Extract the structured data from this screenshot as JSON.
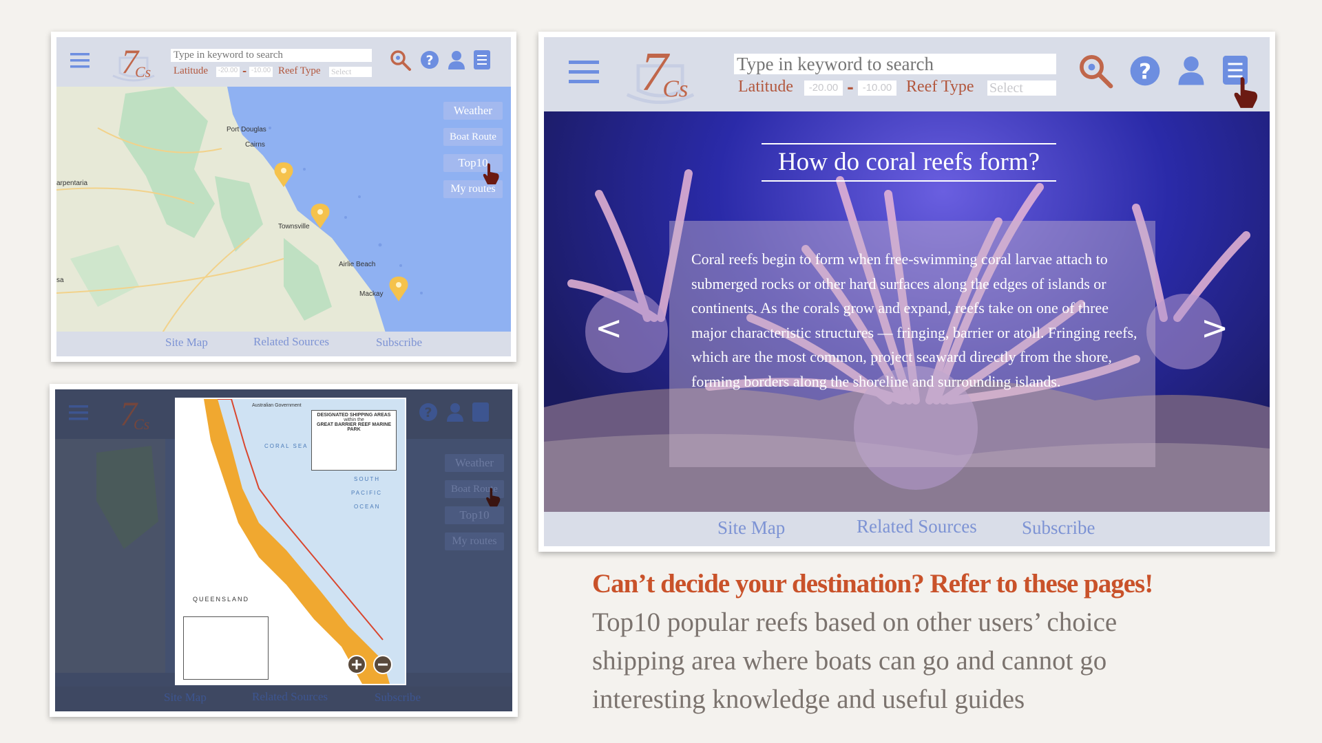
{
  "header": {
    "logo_text": "7Cs",
    "search_placeholder": "Type in keyword to search",
    "latitude_label": "Latitude",
    "lat_min": "-20.00",
    "lat_max": "-10.00",
    "reef_type_label": "Reef Type",
    "reef_type_value": "Select"
  },
  "footer": {
    "site_map": "Site Map",
    "related_sources": "Related Sources",
    "subscribe": "Subscribe"
  },
  "map_buttons": [
    "Weather",
    "Boat Route",
    "Top10",
    "My routes"
  ],
  "map_places": [
    "Port Douglas",
    "Cairns",
    "arpentaria",
    "Townsville",
    "Airlie Beach",
    "Mackay",
    "sa"
  ],
  "shipping_map": {
    "title": "DESIGNATED SHIPPING AREAS",
    "subtitle": "within the",
    "park": "GREAT BARRIER REEF MARINE PARK",
    "agency": "Australian Government",
    "labels": [
      "CORAL SEA",
      "SOUTH",
      "PACIFIC",
      "OCEAN",
      "QUEENSLAND"
    ]
  },
  "article": {
    "title": "How do coral reefs form?",
    "body": "Coral reefs begin to form when free-swimming coral larvae attach to submerged rocks or other hard surfaces along the edges of islands or continents. As the corals grow and expand, reefs take on one of three major characteristic structures — fringing, barrier or atoll. Fringing reefs, which are the most common, project seaward directly from the shore, forming borders along the shoreline and surrounding islands.",
    "prev": "<",
    "next": ">"
  },
  "caption": {
    "headline": "Can’t decide your destination? Refer to these pages!",
    "line1": "Top10 popular reefs based on other users’ choice",
    "line2": "shipping area where boats can go and cannot go",
    "line3": "interesting knowledge and useful guides"
  },
  "colors": {
    "accent": "#b2573d",
    "link_blue": "#7d93d4",
    "icon_blue": "#6d8ee0",
    "header_bg": "#d9dde8",
    "map_water": "#8fb1f2",
    "caption_gray": "#7b736e"
  }
}
